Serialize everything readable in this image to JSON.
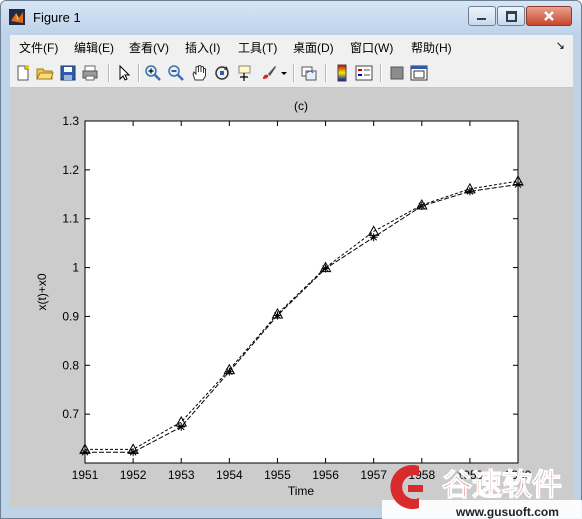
{
  "window": {
    "title": "Figure 1"
  },
  "menu": [
    "文件(F)",
    "编辑(E)",
    "查看(V)",
    "插入(I)",
    "工具(T)",
    "桌面(D)",
    "窗口(W)",
    "帮助(H)"
  ],
  "menu_overflow": "↘",
  "toolbar": {
    "icons": [
      "new-figure-icon",
      "open-file-icon",
      "save-icon",
      "print-icon",
      "pointer-icon",
      "zoom-in-icon",
      "zoom-out-icon",
      "pan-hand-icon",
      "rotate-3d-icon",
      "data-cursor-icon",
      "brush-icon",
      "brush-dropdown-icon",
      "link-plot-icon",
      "colorbar-icon",
      "legend-icon",
      "hide-plot-tools-icon",
      "show-plot-tools-icon"
    ]
  },
  "watermark": {
    "brand": "谷速软件",
    "url": "www.gusuoft.com"
  },
  "chart_data": {
    "type": "line",
    "title": "(c)",
    "xlabel": "Time",
    "ylabel": "x(t)+x0",
    "xlim": [
      1951,
      1960
    ],
    "ylim": [
      0.6,
      1.3
    ],
    "x_ticks": [
      "1951",
      "1952",
      "1953",
      "1954",
      "1955",
      "1956",
      "1957",
      "1958",
      "1959",
      "1960"
    ],
    "y_ticks": [
      "0.7",
      "0.8",
      "0.9",
      "1",
      "1.1",
      "1.2",
      "1.3"
    ],
    "grid": false,
    "x": [
      1951,
      1952,
      1953,
      1954,
      1955,
      1956,
      1957,
      1958,
      1959,
      1960
    ],
    "series": [
      {
        "marker": "triangle",
        "values": [
          0.628,
          0.628,
          0.684,
          0.791,
          0.905,
          1.0,
          1.074,
          1.128,
          1.161,
          1.177
        ]
      },
      {
        "marker": "star",
        "values": [
          0.622,
          0.622,
          0.674,
          0.787,
          0.902,
          0.998,
          1.062,
          1.126,
          1.156,
          1.17
        ]
      }
    ]
  }
}
